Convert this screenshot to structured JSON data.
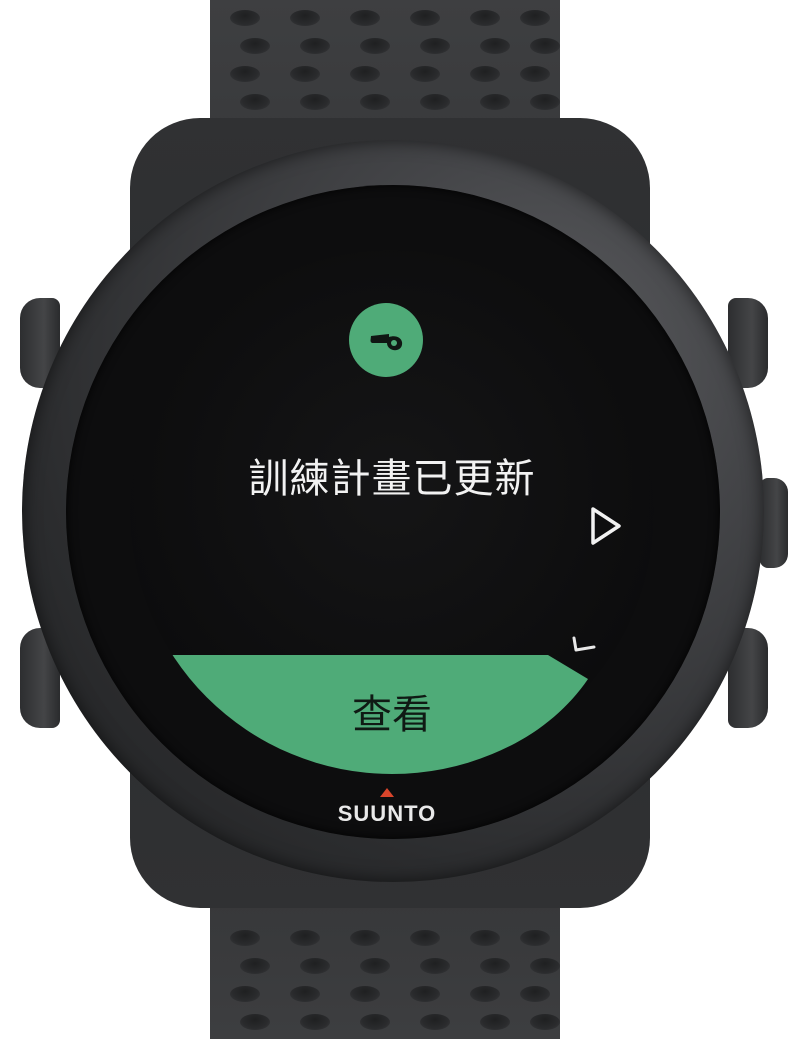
{
  "device": {
    "brand": "SUUNTO",
    "accent_color": "#4fab78",
    "marker_color": "#d9452b"
  },
  "screen": {
    "icon": "whistle-icon",
    "message": "訓練計畫已更新",
    "next_icon": "chevron-right-icon",
    "action": {
      "label": "查看",
      "confirm_icon": "checkmark-icon"
    }
  }
}
